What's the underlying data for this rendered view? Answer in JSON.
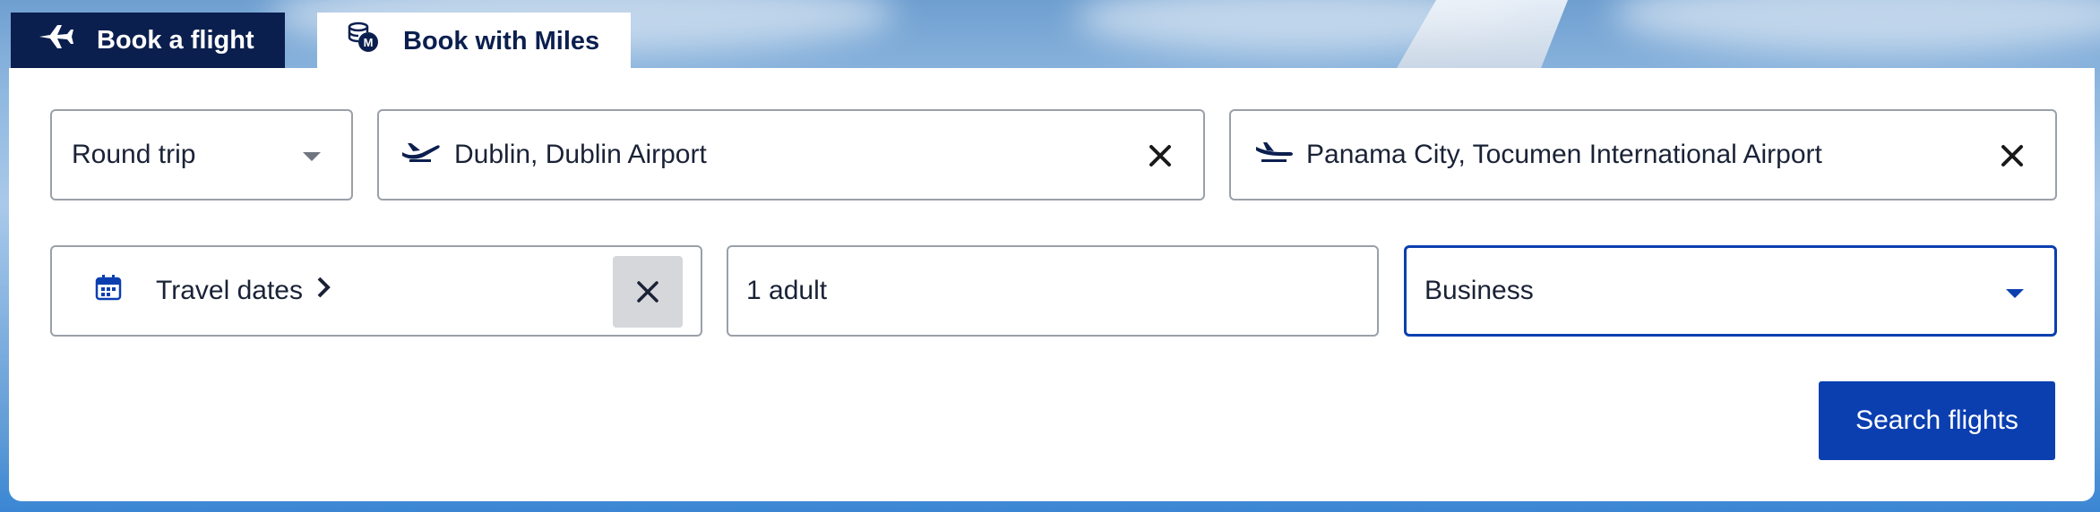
{
  "tabs": {
    "book_flight": "Book a flight",
    "book_miles": "Book with Miles"
  },
  "form": {
    "trip_type": "Round trip",
    "origin": "Dublin, Dublin Airport",
    "destination": "Panama City, Tocumen International Airport",
    "travel_dates": "Travel dates",
    "passengers": "1 adult",
    "cabin": "Business",
    "search_label": "Search flights"
  },
  "icons": {
    "tab_flight": "airplane-icon",
    "tab_miles": "miles-coins-icon",
    "origin": "takeoff-icon",
    "destination": "landing-icon",
    "dates": "calendar-icon",
    "dates_arrow": "chevron-right-icon",
    "clear": "close-icon",
    "dropdown": "caret-down-icon"
  },
  "colors": {
    "navy": "#0b1f4f",
    "accent_blue": "#0b3fb0",
    "border": "#9aa0a8"
  }
}
